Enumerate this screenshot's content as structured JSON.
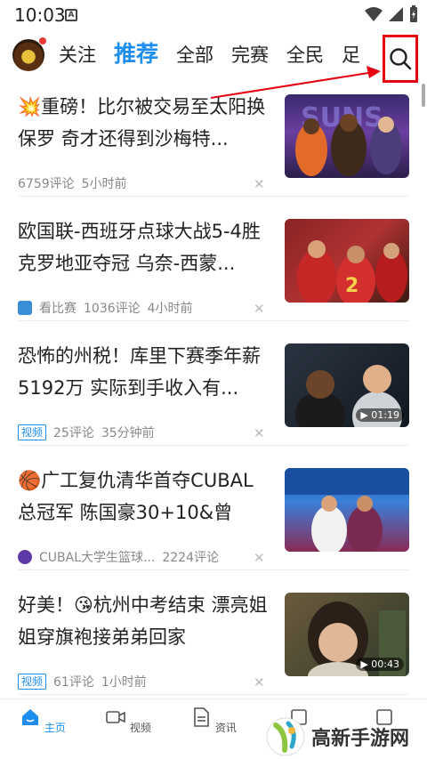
{
  "status": {
    "time": "10:03",
    "badge": "A"
  },
  "nav": {
    "tabs": [
      {
        "label": "关注"
      },
      {
        "label": "推荐"
      },
      {
        "label": "全部"
      },
      {
        "label": "完赛"
      },
      {
        "label": "全民"
      },
      {
        "label": "足"
      }
    ],
    "active_tab": "推荐"
  },
  "feed": [
    {
      "emoji": "💥",
      "title": "重磅！比尔被交易至太阳换保罗 奇才还得到沙梅特...",
      "comments": "6759评论",
      "time": "5小时前",
      "thumb_color": "#3a2a6e"
    },
    {
      "title": "欧国联-西班牙点球大战5-4胜克罗地亚夺冠 乌奈-西蒙...",
      "source": "看比赛",
      "comments": "1036评论",
      "time": "4小时前",
      "thumb_color": "#8a2323"
    },
    {
      "title": "恐怖的州税！库里下赛季年薪5192万 实际到手收入有...",
      "tag": "视频",
      "comments": "25评论",
      "time": "35分钟前",
      "duration": "01:19",
      "thumb_color": "#222a33"
    },
    {
      "emoji": "🏀",
      "title": "广工复仇清华首夺CUBAL总冠军 陈国豪30+10&曾煜...",
      "source": "CUBAL大学生篮球...",
      "comments": "2224评论",
      "thumb_color": "#1f5fb8"
    },
    {
      "title": "好美！😘杭州中考结束 漂亮姐姐穿旗袍接弟弟回家",
      "tag": "视频",
      "comments": "61评论",
      "time": "1小时前",
      "duration": "00:43",
      "thumb_color": "#6b5a3d"
    }
  ],
  "bottom_nav": [
    {
      "label": "主页"
    },
    {
      "label": "视频"
    },
    {
      "label": "资讯"
    },
    {
      "label": ""
    },
    {
      "label": ""
    }
  ],
  "watermark": "高新手游网"
}
